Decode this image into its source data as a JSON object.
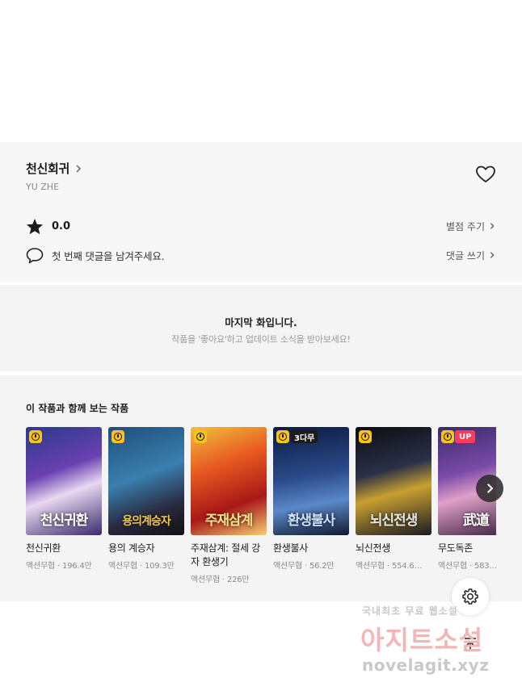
{
  "work": {
    "title": "천신회귀",
    "author": "YU ZHE",
    "rating": "0.0",
    "rate_label": "별점 주기",
    "comment_prompt": "첫 번째 댓글을 남겨주세요.",
    "comment_label": "댓글 쓰기"
  },
  "last_episode": {
    "title": "마지막 화입니다.",
    "subtitle": "작품을 '좋아요'하고 업데이트 소식을 받아보세요!"
  },
  "recommend": {
    "heading": "이 작품과 함께 보는 작품",
    "items": [
      {
        "name": "천신귀환",
        "genre": "액션무협",
        "views": "196.4만",
        "cover_text": "천신귀환",
        "badge": "clock",
        "cover_color": "#6a40b0"
      },
      {
        "name": "용의 계승자",
        "genre": "액션무협",
        "views": "109.3만",
        "cover_text": "용의계승자",
        "badge": "clock",
        "cover_color": "#3a7fae"
      },
      {
        "name": "주재삼계: 절세 강자 환생기",
        "genre": "액션무협",
        "views": "226만",
        "cover_text": "주재삼계",
        "badge": "clock",
        "cover_color": "#e85a20"
      },
      {
        "name": "환생불사",
        "genre": "액션무협",
        "views": "56.2만",
        "cover_text": "환생불사",
        "badge": "clock",
        "badge_text": "3다무",
        "cover_color": "#2b4a8a"
      },
      {
        "name": "뇌신전생",
        "genre": "액션무협",
        "views": "554.6…",
        "cover_text": "뇌신전생",
        "badge": "clock",
        "cover_color": "#2a3048"
      },
      {
        "name": "무도독존",
        "genre": "액션무협",
        "views": "583.…",
        "cover_text": "武道",
        "badge": "up",
        "badge_text": "UP",
        "cover_color": "#7a4aa8"
      }
    ],
    "separator": " · "
  },
  "watermark": {
    "line1": "국내최초 무료 웹소설",
    "line2": "아지트소설",
    "line3": "novelagit.xyz"
  },
  "icons": {
    "title_chevron": "chevron-right-icon",
    "heart": "heart-icon",
    "star": "star-icon",
    "comment": "comment-bubble-icon",
    "next": "chevron-right-icon",
    "settings": "gear-icon",
    "top": "arrow-up-icon"
  },
  "colors": {
    "badge_yellow": "#f9c31a",
    "badge_up": "#ff3b5a",
    "panel_bg": "#f4f4f4"
  }
}
